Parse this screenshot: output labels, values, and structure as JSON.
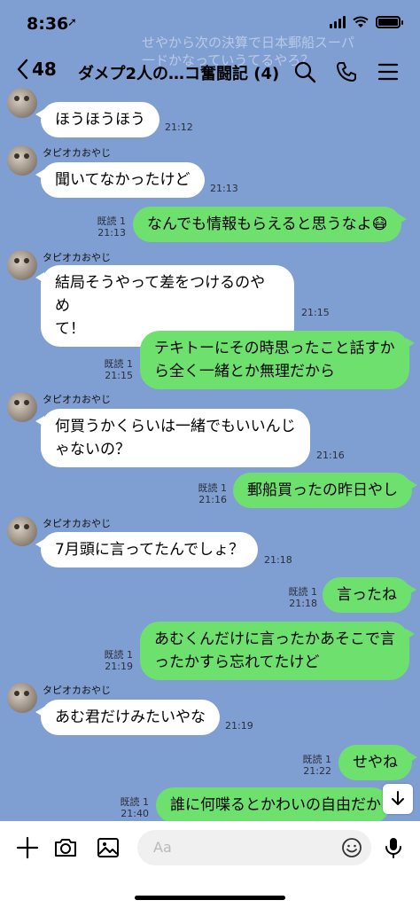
{
  "status": {
    "time": "8:36"
  },
  "header": {
    "back_count": "48",
    "title": "ダメプ2人の…コ奮闘記 (4)"
  },
  "banner_text": "せやから次の決算で日本郵船スーパ\n一ドかなっていうてるやろ？",
  "sender_name": "タピオカおやじ",
  "messages": [
    {
      "type": "in",
      "text": "ほうほうほう",
      "time": "21:12",
      "show_sender": false
    },
    {
      "type": "in",
      "text": "聞いてなかったけど",
      "time": "21:13",
      "show_sender": true
    },
    {
      "type": "out",
      "text": "なんでも情報もらえると思うなよ😷",
      "read": "既読 1",
      "time": "21:13"
    },
    {
      "type": "in",
      "text": "結局そうやって差をつけるのやめ\nて！",
      "time": "21:15",
      "show_sender": true
    },
    {
      "type": "out",
      "text": "テキトーにその時思ったこと話すか\nら全く一緒とか無理だから",
      "read": "既読 1",
      "time": "21:15"
    },
    {
      "type": "in",
      "text": "何買うかくらいは一緒でもいいんじ\nゃないの？",
      "time": "21:16",
      "show_sender": true
    },
    {
      "type": "out",
      "text": "郵船買ったの昨日やし",
      "read": "既読 1",
      "time": "21:16"
    },
    {
      "type": "in",
      "text": "7月頭に言ってたんでしょ？",
      "time": "21:18",
      "show_sender": true
    },
    {
      "type": "out",
      "text": "言ったね",
      "read": "既読 1",
      "time": "21:18"
    },
    {
      "type": "out",
      "text": "あむくんだけに言ったかあそこで言\nったかすら忘れてたけど",
      "read": "既読 1",
      "time": "21:19"
    },
    {
      "type": "in",
      "text": "あむ君だけみたいやな",
      "time": "21:19",
      "show_sender": true
    },
    {
      "type": "out",
      "text": "せやね",
      "read": "既読 1",
      "time": "21:22"
    },
    {
      "type": "out",
      "text": "誰に何喋るとかわいの自由だか",
      "read": "既読 1",
      "time": "21:40"
    }
  ],
  "footer": {
    "input_placeholder": "Aa"
  },
  "icons": [
    "back-chevron-icon",
    "search-icon",
    "phone-icon",
    "menu-icon",
    "plus-icon",
    "camera-icon",
    "image-icon",
    "emoji-icon",
    "mic-icon",
    "scroll-down-icon"
  ]
}
